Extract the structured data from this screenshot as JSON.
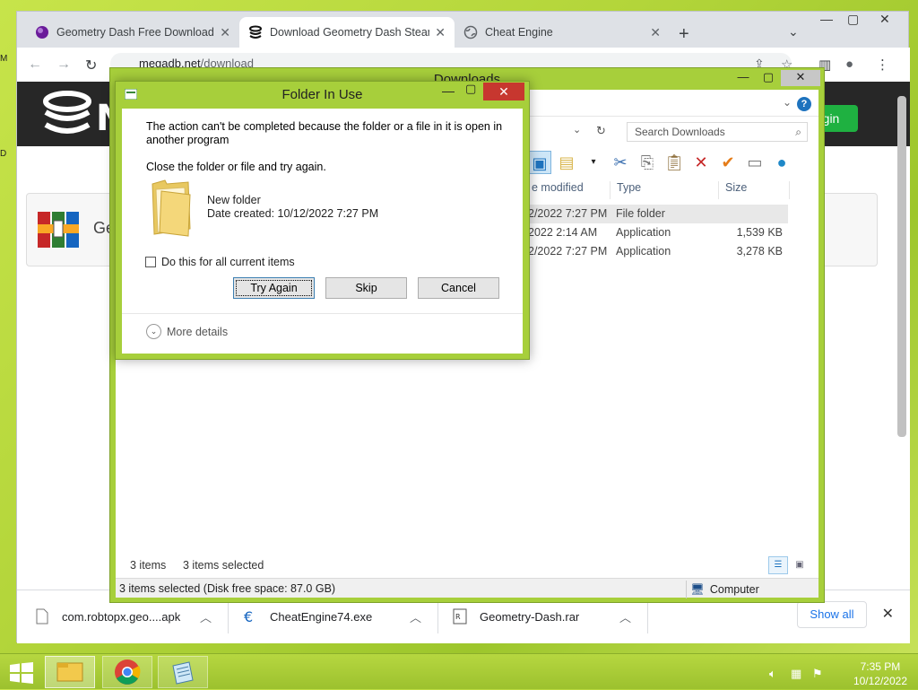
{
  "browser": {
    "tabs": [
      {
        "title": "Geometry Dash Free Download [",
        "icon": "geometry-dash-favicon",
        "active": false
      },
      {
        "title": "Download Geometry Dash Steam",
        "icon": "megadb-favicon",
        "active": true
      },
      {
        "title": "Cheat Engine",
        "icon": "globe-icon",
        "active": false
      }
    ],
    "new_tab": "+",
    "tab_search": "⌄",
    "window_buttons": {
      "minimize": "—",
      "maximize": "▢",
      "close": "✕"
    },
    "address": {
      "domain": "megadb.net",
      "path": "/download"
    },
    "site_login": "gin",
    "site_file_label": "Ge",
    "downloads": [
      {
        "name": "com.robtopx.geo....apk",
        "icon": "file-icon"
      },
      {
        "name": "CheatEngine74.exe",
        "icon": "cheat-engine-icon"
      },
      {
        "name": "Geometry-Dash.rar",
        "icon": "rar-archive-icon"
      }
    ],
    "show_all": "Show all"
  },
  "explorer": {
    "title": "Downloads",
    "search_placeholder": "Search Downloads",
    "columns": [
      "e modified",
      "Type",
      "Size"
    ],
    "rows": [
      {
        "modified": "2/2022 7:27 PM",
        "type": "File folder",
        "size": ""
      },
      {
        "modified": "2022 2:14 AM",
        "type": "Application",
        "size": "1,539 KB"
      },
      {
        "modified": "2/2022 7:27 PM",
        "type": "Application",
        "size": "3,278 KB"
      }
    ],
    "status_items": "3 items",
    "status_selected": "3 items selected",
    "bottom_left": "3 items selected (Disk free space: 87.0 GB)",
    "bottom_right": "Computer"
  },
  "dialog": {
    "title": "Folder In Use",
    "message": "The action can't be completed because the folder or a file in it is open in another program",
    "instruction": "Close the folder or file and try again.",
    "item_name": "New folder",
    "item_date": "Date created: 10/12/2022 7:27 PM",
    "checkbox_label": "Do this for all current items",
    "buttons": {
      "try_again": "Try Again",
      "skip": "Skip",
      "cancel": "Cancel"
    },
    "more_details": "More details"
  },
  "taskbar": {
    "time": "7:35 PM",
    "date": "10/12/2022"
  }
}
